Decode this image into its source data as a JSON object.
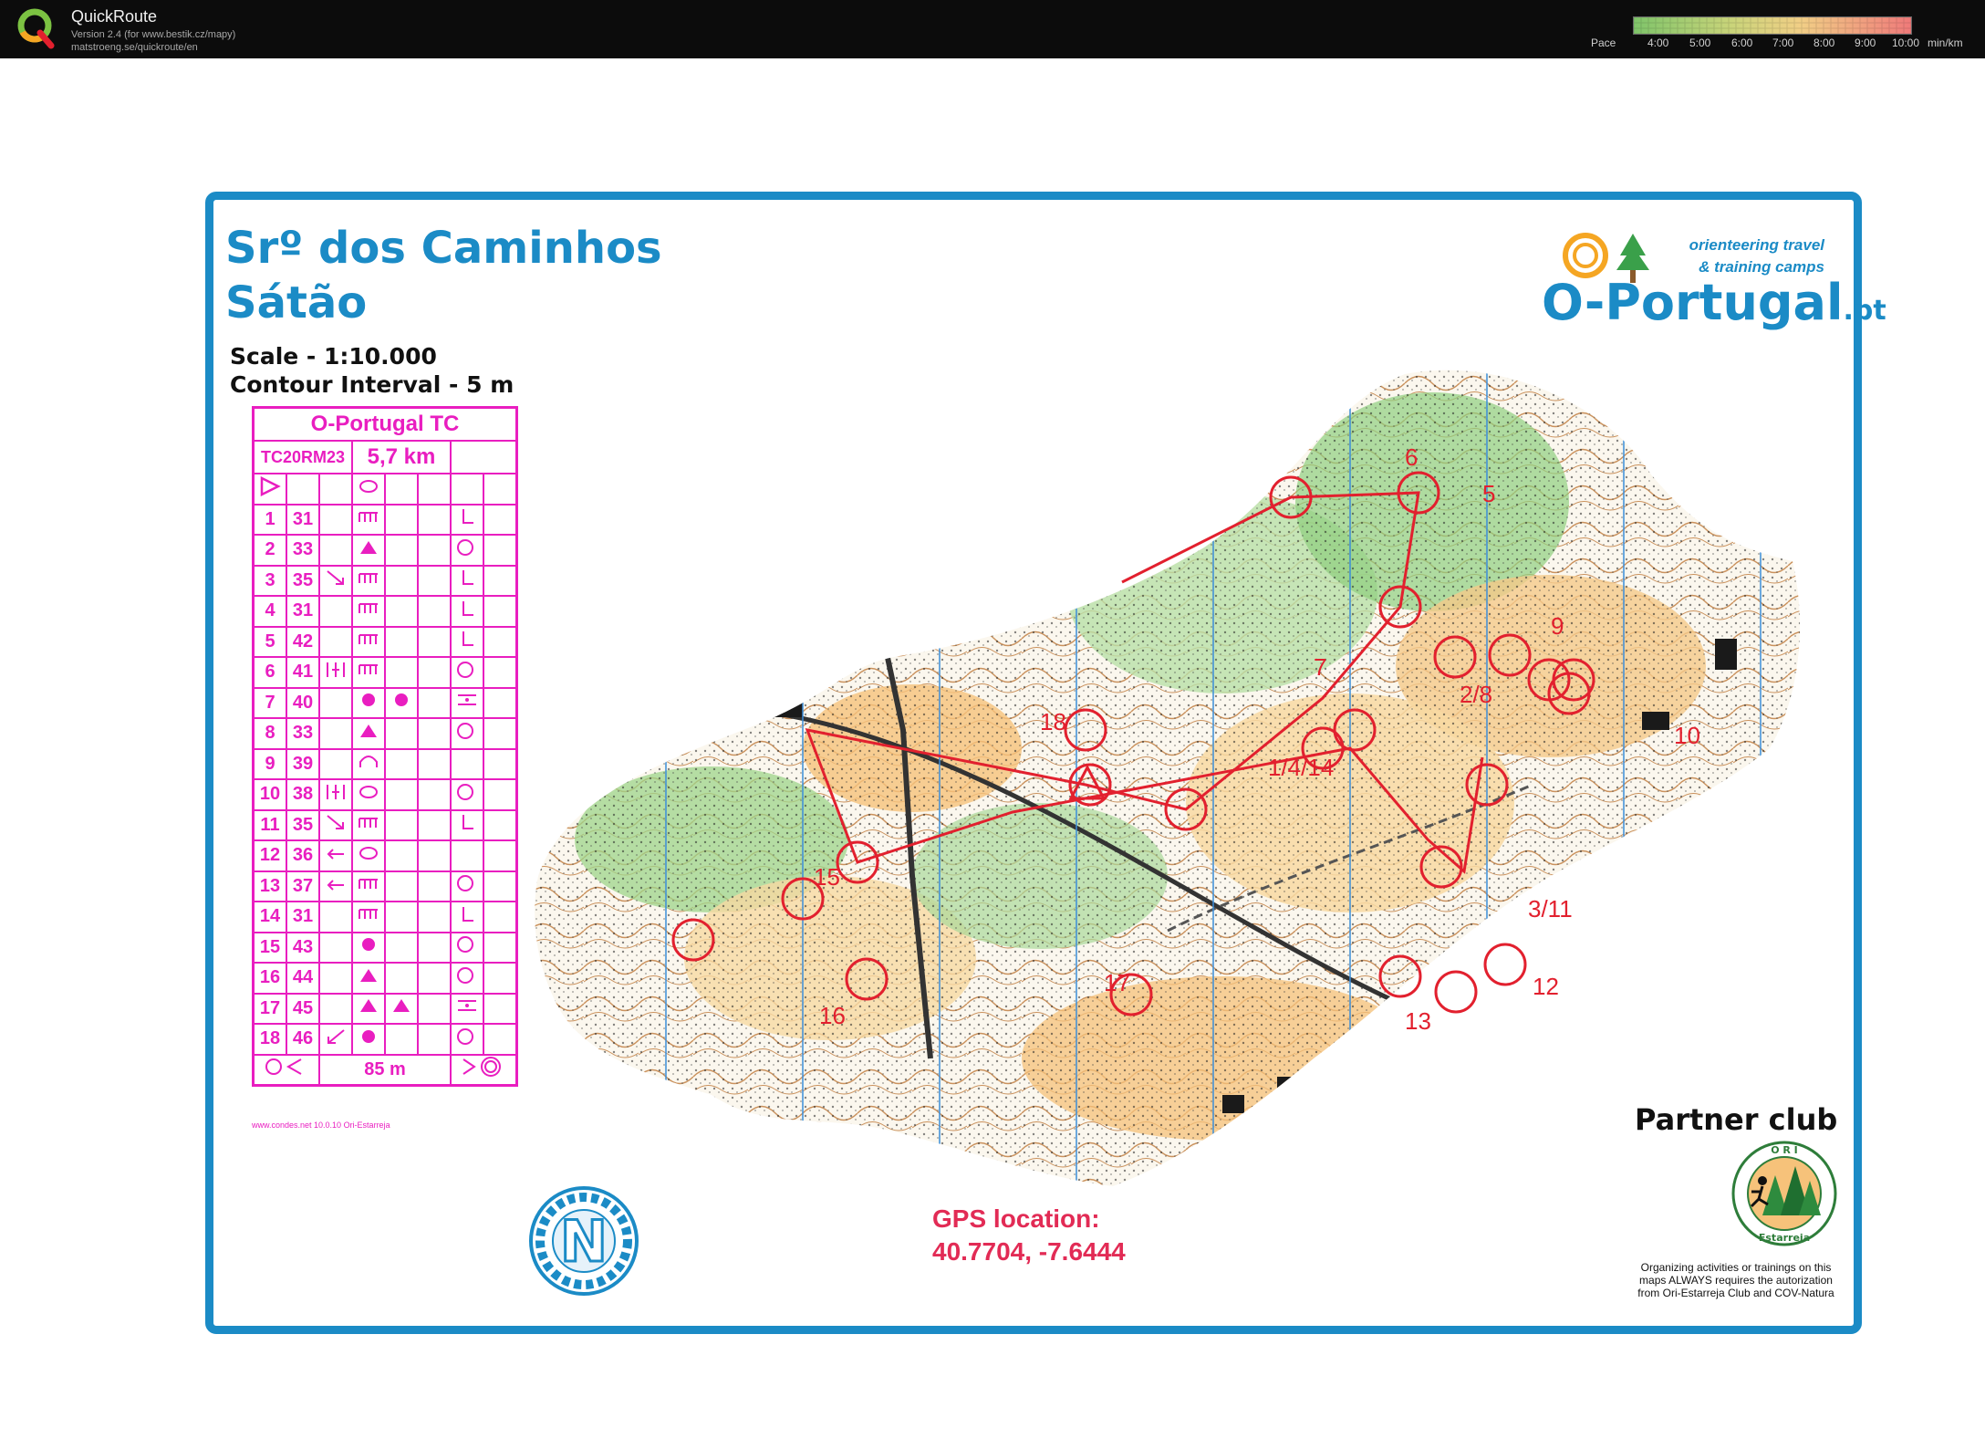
{
  "app": {
    "name": "QuickRoute",
    "version_line": "Version 2.4  (for www.bestik.cz/mapy)",
    "url_line": "matstroeng.se/quickroute/en",
    "pace_label": "Pace",
    "pace_ticks": [
      "4:00",
      "5:00",
      "6:00",
      "7:00",
      "8:00",
      "9:00",
      "10:00",
      "min/km"
    ]
  },
  "map": {
    "title_line1": "Srº dos Caminhos",
    "title_line2": "Sátão",
    "scale_text": "Scale - 1:10.000",
    "contour_text": "Contour Interval -  5 m",
    "logo_main": "O-Portugal",
    "logo_suffix": ".pt",
    "tagline_1": "orienteering travel",
    "tagline_2": "& training camps",
    "partner_label": "Partner club",
    "gps_label": "GPS location:",
    "gps_value": "40.7704, -7.6444",
    "legal_text": "Organizing activities or trainings on this maps ALWAYS requires the autorization from Ori-Estarreja Club and COV-Natura",
    "club_ring_top": "O R I",
    "club_ring_bottom": "Estarreja",
    "north_letter": "N",
    "colors": {
      "frame": "#1b8bc6",
      "description": "#e91ec0",
      "course": "#e2202e",
      "gps": "#e22b55"
    }
  },
  "control_description": {
    "event": "O-Portugal TC",
    "course_code": "TC20RM23",
    "length": "5,7 km",
    "rows": [
      {
        "n": "1",
        "code": "31"
      },
      {
        "n": "2",
        "code": "33"
      },
      {
        "n": "3",
        "code": "35"
      },
      {
        "n": "4",
        "code": "31"
      },
      {
        "n": "5",
        "code": "42"
      },
      {
        "n": "6",
        "code": "41"
      },
      {
        "n": "7",
        "code": "40"
      },
      {
        "n": "8",
        "code": "33"
      },
      {
        "n": "9",
        "code": "39"
      },
      {
        "n": "10",
        "code": "38"
      },
      {
        "n": "11",
        "code": "35"
      },
      {
        "n": "12",
        "code": "36"
      },
      {
        "n": "13",
        "code": "37"
      },
      {
        "n": "14",
        "code": "31"
      },
      {
        "n": "15",
        "code": "43"
      },
      {
        "n": "16",
        "code": "44"
      },
      {
        "n": "17",
        "code": "45"
      },
      {
        "n": "18",
        "code": "46"
      }
    ],
    "finish_distance": "85 m",
    "footer": "www.condes.net 10.0.10 Ori-Estarreja"
  },
  "course_labels": [
    "6",
    "5",
    "9",
    "10",
    "2/8",
    "7",
    "1/4/14",
    "18",
    "15",
    "16",
    "17",
    "3/11",
    "12",
    "13"
  ]
}
